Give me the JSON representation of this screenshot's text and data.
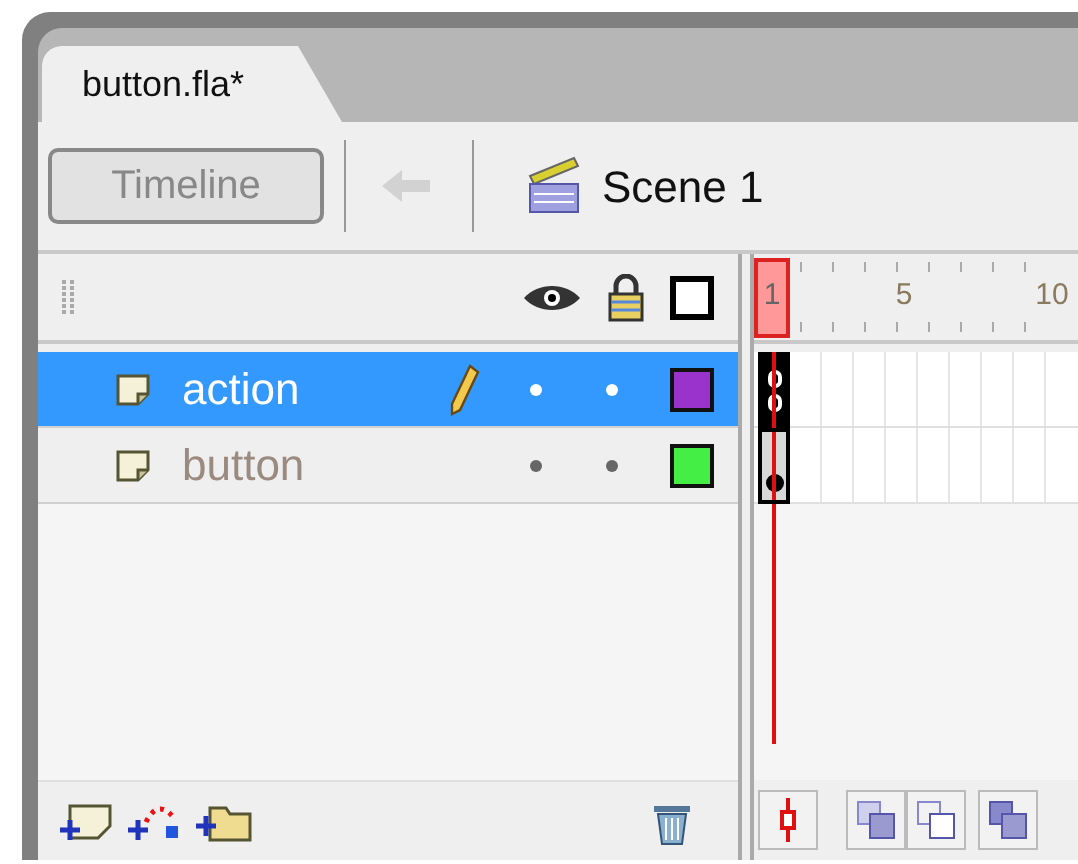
{
  "document_tab": {
    "label": "button.fla*",
    "selected": true
  },
  "toolbar": {
    "timeline_button": "Timeline",
    "back_disabled": true,
    "scene": "Scene 1"
  },
  "ruler": {
    "labels": [
      {
        "frame": "1",
        "selected": true
      },
      {
        "frame": "5",
        "selected": false
      },
      {
        "frame": "10",
        "selected": false
      }
    ]
  },
  "layers": [
    {
      "name": "action",
      "selected": true,
      "editing": true,
      "color": "#9933cc",
      "kind": "actions"
    },
    {
      "name": "button",
      "selected": false,
      "editing": false,
      "color": "#44ee44",
      "kind": "content"
    }
  ]
}
